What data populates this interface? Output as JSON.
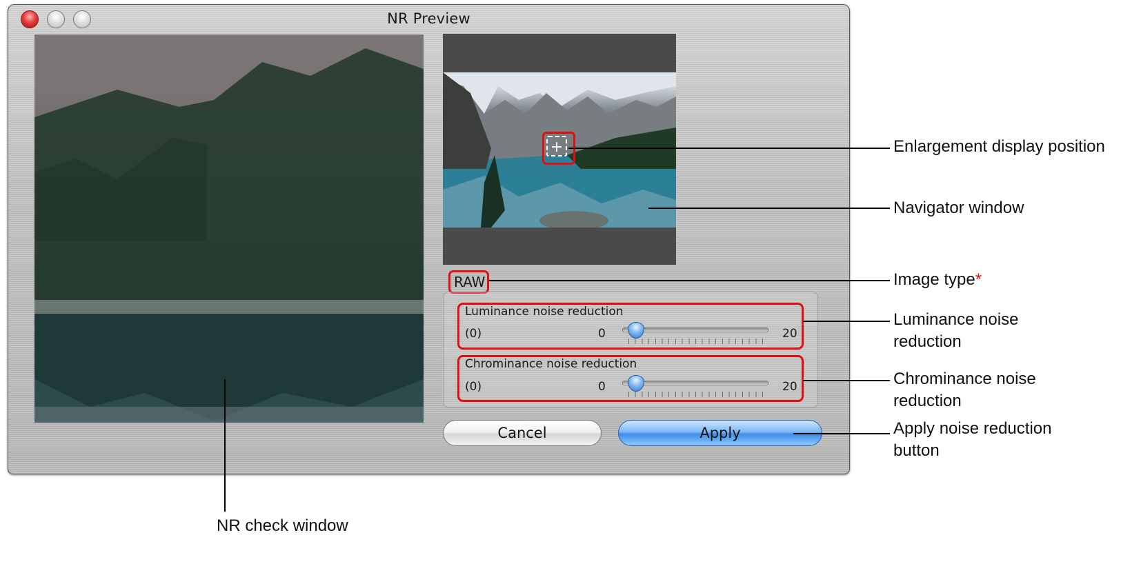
{
  "window": {
    "title": "NR Preview"
  },
  "image_type": "RAW",
  "luminance": {
    "label": "Luminance noise reduction",
    "current": "(0)",
    "min": "0",
    "max": "20",
    "value": 0
  },
  "chrominance": {
    "label": "Chrominance noise reduction",
    "current": "(0)",
    "min": "0",
    "max": "20",
    "value": 0
  },
  "buttons": {
    "cancel": "Cancel",
    "apply": "Apply"
  },
  "callouts": {
    "enlargement": "Enlargement display position",
    "navigator": "Navigator window",
    "image_type": "Image type",
    "image_type_mark": "*",
    "luminance": "Luminance noise reduction",
    "chrominance": "Chrominance noise reduction",
    "apply": "Apply noise reduction button",
    "nr_check": "NR check window"
  },
  "colors": {
    "highlight": "#e01010",
    "apply_button": "#3f8ee8"
  },
  "icons": {
    "enlarge": "enlargement-position-icon"
  }
}
